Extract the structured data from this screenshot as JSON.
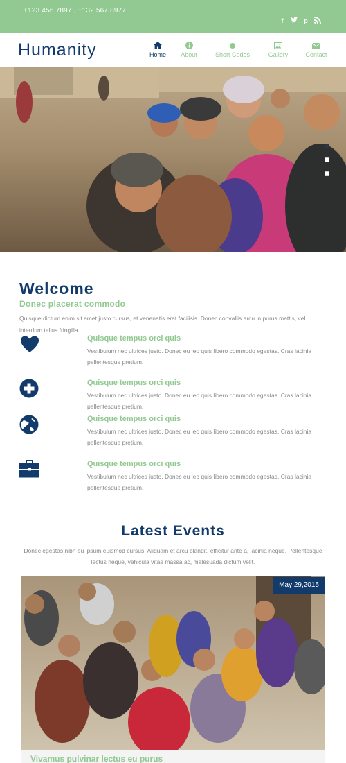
{
  "topbar": {
    "phone": "+123 456 7897 , +132 567 8977",
    "social": [
      "f",
      "t",
      "p",
      "rss"
    ]
  },
  "header": {
    "logo": "Humanity",
    "nav": [
      {
        "label": "Home",
        "icon": "home-icon"
      },
      {
        "label": "About",
        "icon": "info-icon"
      },
      {
        "label": "Short Codes",
        "icon": "dot-icon"
      },
      {
        "label": "Gallery",
        "icon": "image-icon"
      },
      {
        "label": "Contact",
        "icon": "mail-icon"
      }
    ]
  },
  "welcome": {
    "title": "Welcome",
    "subtitle": "Donec placerat commodo",
    "text": "Quisque dictum enim sit amet justo cursus, et venenatis erat facilisis. Donec convallis arcu in purus mattis, vel interdum tellus fringilla."
  },
  "features": [
    {
      "icon": "heart-icon",
      "title": "Quisque tempus orci quis",
      "text": "Vestibulum nec ultrices justo. Donec eu leo quis libero commodo egestas. Cras lacinia pellentesque pretium."
    },
    {
      "icon": "plus-icon",
      "title": "Quisque tempus orci quis",
      "text": "Vestibulum nec ultrices justo. Donec eu leo quis libero commodo egestas. Cras lacinia pellentesque pretium."
    },
    {
      "icon": "globe-icon",
      "title": "Quisque tempus orci quis",
      "text": "Vestibulum nec ultrices justo. Donec eu leo quis libero commodo egestas. Cras lacinia pellentesque pretium."
    },
    {
      "icon": "briefcase-icon",
      "title": "Quisque tempus orci quis",
      "text": "Vestibulum nec ultrices justo. Donec eu leo quis libero commodo egestas. Cras lacinia pellentesque pretium."
    }
  ],
  "events": {
    "title": "Latest Events",
    "text": "Donec egestas nibh eu ipsum euismod cursus. Aliquam et arcu blandit, efficitur ante a, lacinia neque. Pellentesque lectus neque, vehicula vitae massa ac, malesuada dictum velit.",
    "card": {
      "date": "May 29,2015",
      "title": "Vivamus pulvinar lectus eu purus"
    }
  },
  "colors": {
    "green": "#92c992",
    "navy": "#123a6a",
    "text": "#888888"
  }
}
